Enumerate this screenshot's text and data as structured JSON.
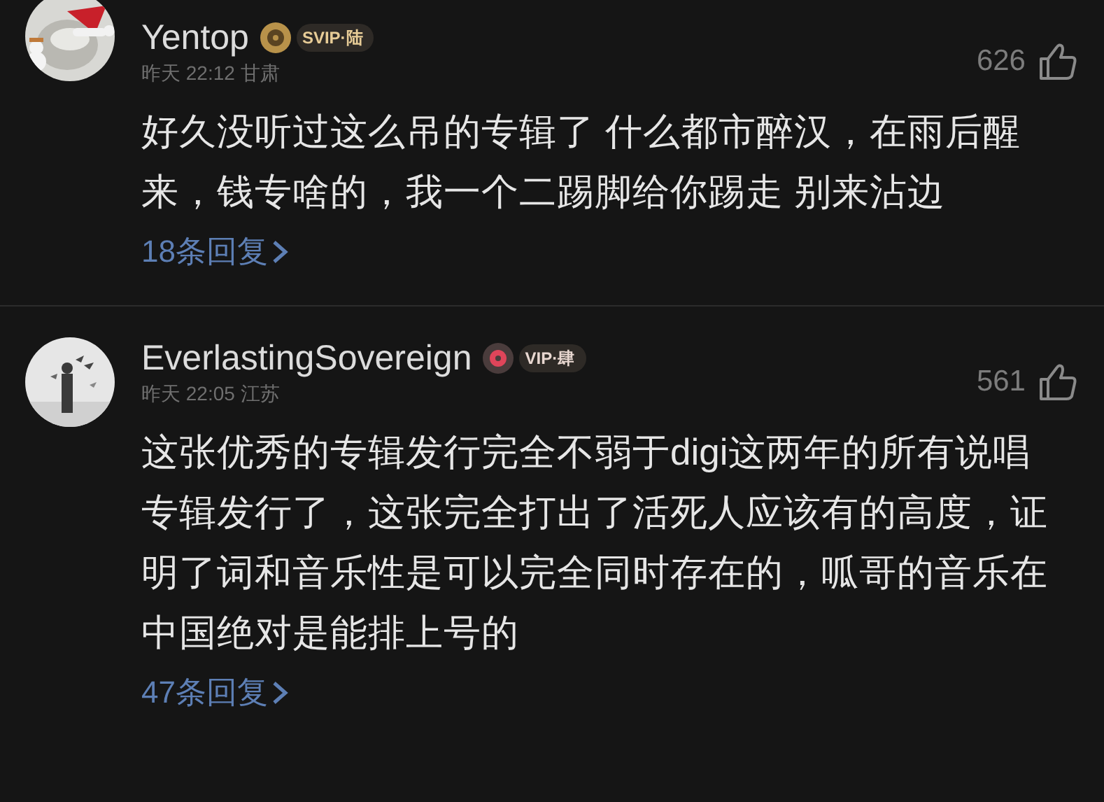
{
  "comments": [
    {
      "name": "Yentop",
      "badge": {
        "kind": "svip",
        "label": "SVIP·陆"
      },
      "time": "昨天 22:12",
      "location": "甘肃",
      "likes": "626",
      "text": "好久没听过这么吊的专辑了 什么都市醉汉，在雨后醒来，钱专啥的，我一个二踢脚给你踢走 别来沾边",
      "replies": "18条回复"
    },
    {
      "name": "EverlastingSovereign",
      "badge": {
        "kind": "vip",
        "label": "VIP·肆"
      },
      "time": "昨天 22:05",
      "location": "江苏",
      "likes": "561",
      "text": "这张优秀的专辑发行完全不弱于digi这两年的所有说唱专辑发行了，这张完全打出了活死人应该有的高度，证明了词和音乐性是可以完全同时存在的，呱哥的音乐在中国绝对是能排上号的",
      "replies": "47条回复"
    }
  ]
}
